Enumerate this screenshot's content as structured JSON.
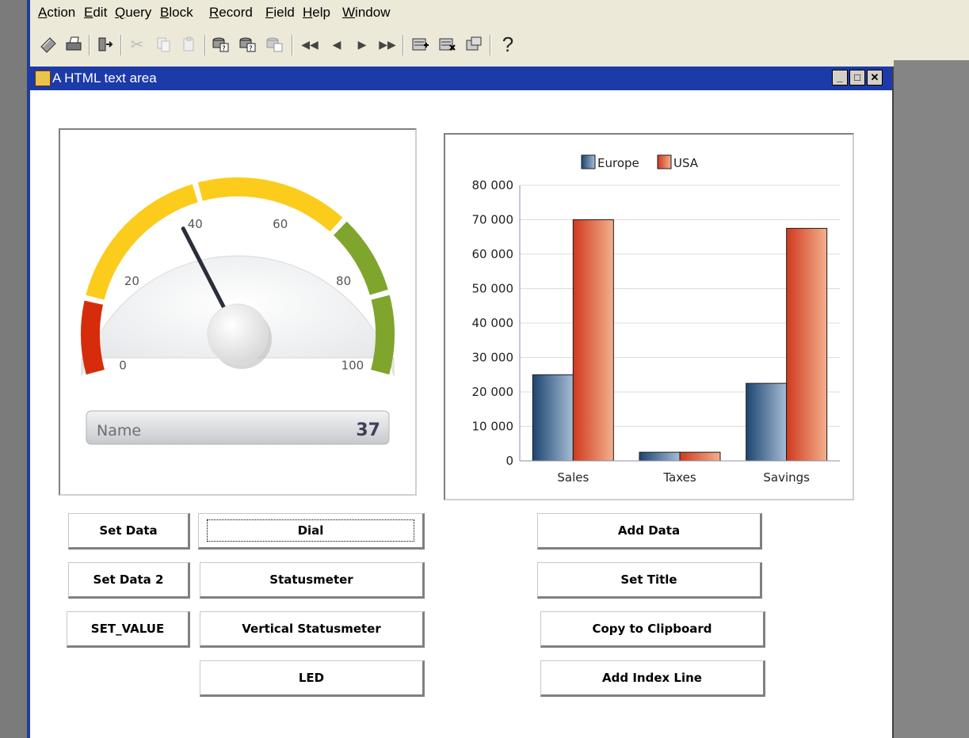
{
  "menu": {
    "items": [
      {
        "label": "Action",
        "mnemonic": "A"
      },
      {
        "label": "Edit",
        "mnemonic": "E"
      },
      {
        "label": "Query",
        "mnemonic": "Q"
      },
      {
        "label": "Block",
        "mnemonic": "B"
      },
      {
        "label": "Record",
        "mnemonic": "R"
      },
      {
        "label": "Field",
        "mnemonic": "F"
      },
      {
        "label": "Help",
        "mnemonic": "H"
      },
      {
        "label": "Window",
        "mnemonic": "W"
      }
    ]
  },
  "toolbar": {
    "icons": [
      "save-icon",
      "print-icon",
      "exit-icon",
      "cut-icon",
      "copy-icon",
      "paste-icon",
      "enter-query-icon",
      "execute-query-icon",
      "cancel-query-icon",
      "first-record-icon",
      "previous-record-icon",
      "next-record-icon",
      "last-record-icon",
      "insert-record-icon",
      "delete-record-icon",
      "duplicate-record-icon",
      "help-icon"
    ],
    "help_glyph": "?"
  },
  "window": {
    "title": "A HTML text area",
    "controls": {
      "minimize": "_",
      "maximize": "□",
      "close": "✕"
    }
  },
  "gauge": {
    "ticks": [
      "0",
      "20",
      "40",
      "60",
      "80",
      "100"
    ],
    "value": 37,
    "value_display": "37",
    "name": "Name",
    "band_colors": {
      "red": "#d72c0c",
      "yellow": "#fccc1c",
      "green": "#7fa52d"
    }
  },
  "chart_data": {
    "type": "bar",
    "categories": [
      "Sales",
      "Taxes",
      "Savings"
    ],
    "series": [
      {
        "name": "Europe",
        "values": [
          25000,
          2500,
          22500
        ],
        "color": "#1d4571"
      },
      {
        "name": "USA",
        "values": [
          70000,
          2500,
          67500
        ],
        "color": "#cf3a1e"
      }
    ],
    "ylim": [
      0,
      80000
    ],
    "yticks": [
      "0",
      "10 000",
      "20 000",
      "30 000",
      "40 000",
      "50 000",
      "60 000",
      "70 000",
      "80 000"
    ],
    "legend": "top",
    "grid": true
  },
  "buttons": {
    "set_data": "Set Data",
    "set_data_2": "Set Data 2",
    "set_value": "SET_VALUE",
    "dial": "Dial",
    "statusmeter": "Statusmeter",
    "vertical_statusmeter": "Vertical Statusmeter",
    "led": "LED",
    "add_data": "Add Data",
    "set_title": "Set Title",
    "copy_to_clipboard": "Copy to Clipboard",
    "add_index_line": "Add Index Line"
  }
}
